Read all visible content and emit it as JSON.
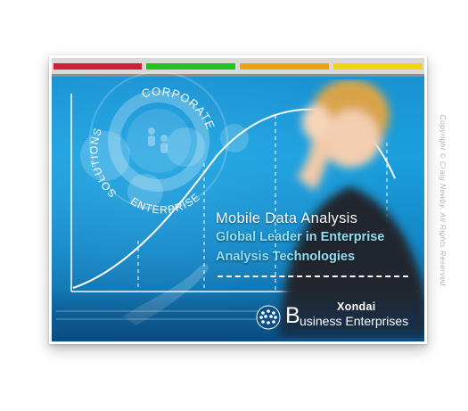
{
  "stripes": [
    {
      "name": "red",
      "color": "#d31f3e"
    },
    {
      "name": "green",
      "color": "#22c21e"
    },
    {
      "name": "orange",
      "color": "#f2a20e"
    },
    {
      "name": "yellow",
      "color": "#eed411"
    }
  ],
  "ring_words": {
    "corporate": "CORPORATE",
    "enterprise": "ENTERPRISE",
    "solutions": "SOLUTIONS"
  },
  "headline": "Mobile  Data  Analysis",
  "tagline": {
    "line1": "Global Leader in Enterprise",
    "line2": "Analysis Technologies"
  },
  "logo": {
    "name": "Xondai",
    "initial": "B",
    "rest": "usiness Enterprises",
    "globe_icon": "globe-icon"
  },
  "copyright": "Copyright © Craig Newby, All Rights Reserved.",
  "colors": {
    "background_blue": "#1aa0dd",
    "tagline": "#8fe0f5"
  }
}
